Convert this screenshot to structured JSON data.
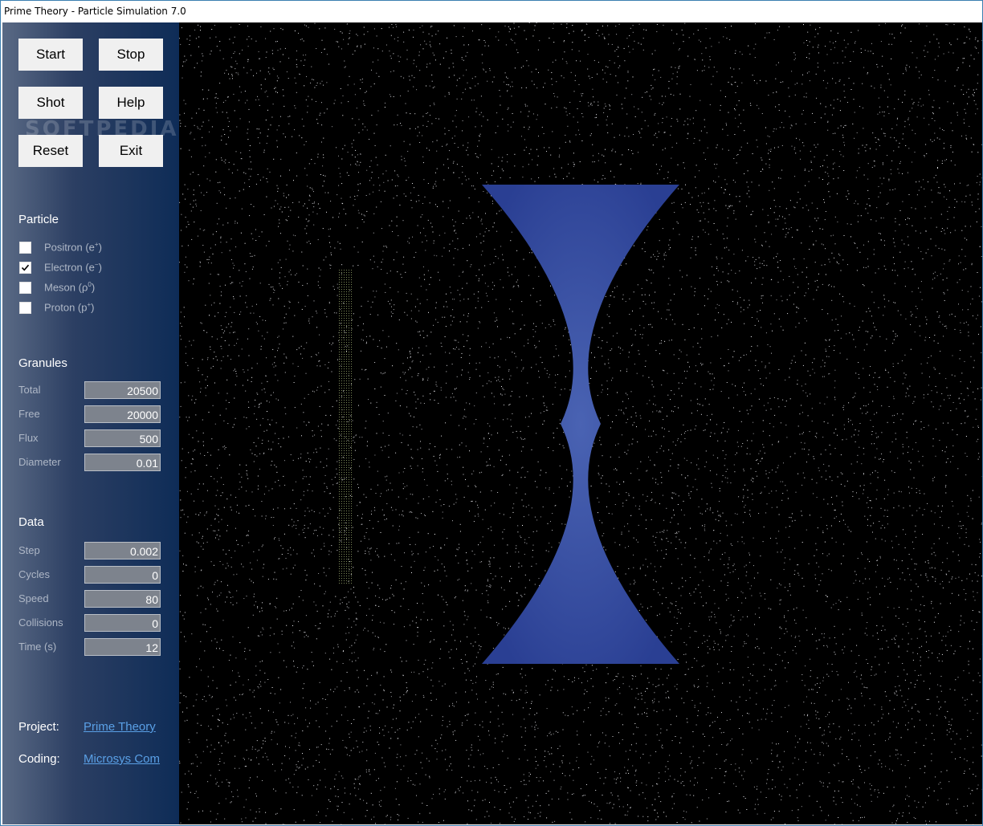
{
  "window": {
    "title": "Prime Theory - Particle Simulation 7.0"
  },
  "buttons": {
    "start": "Start",
    "stop": "Stop",
    "shot": "Shot",
    "help": "Help",
    "reset": "Reset",
    "exit": "Exit"
  },
  "watermark": "SOFTPEDIA",
  "particle": {
    "title": "Particle",
    "options": [
      {
        "name": "Positron",
        "symbol": "e",
        "sup": "+",
        "checked": false
      },
      {
        "name": "Electron",
        "symbol": "e",
        "sup": "−",
        "checked": true
      },
      {
        "name": "Meson",
        "symbol": "ρ",
        "sup": "0",
        "checked": false
      },
      {
        "name": "Proton",
        "symbol": "p",
        "sup": "+",
        "checked": false
      }
    ]
  },
  "granules": {
    "title": "Granules",
    "fields": [
      {
        "label": "Total",
        "value": "20500"
      },
      {
        "label": "Free",
        "value": "20000"
      },
      {
        "label": "Flux",
        "value": "500"
      },
      {
        "label": "Diameter",
        "value": "0.01"
      }
    ]
  },
  "data": {
    "title": "Data",
    "fields": [
      {
        "label": "Step",
        "value": "0.002"
      },
      {
        "label": "Cycles",
        "value": "0"
      },
      {
        "label": "Speed",
        "value": "80"
      },
      {
        "label": "Collisions",
        "value": "0"
      },
      {
        "label": "Time (s)",
        "value": "12"
      }
    ]
  },
  "footer": {
    "project_label": "Project:",
    "project_link": "Prime Theory",
    "coding_label": "Coding:",
    "coding_link": "Microsys Com"
  },
  "colors": {
    "lens_edge": "#2a3f93",
    "lens_center": "#4a63b3",
    "canvas_bg": "#000000",
    "link": "#5aa0e6"
  }
}
